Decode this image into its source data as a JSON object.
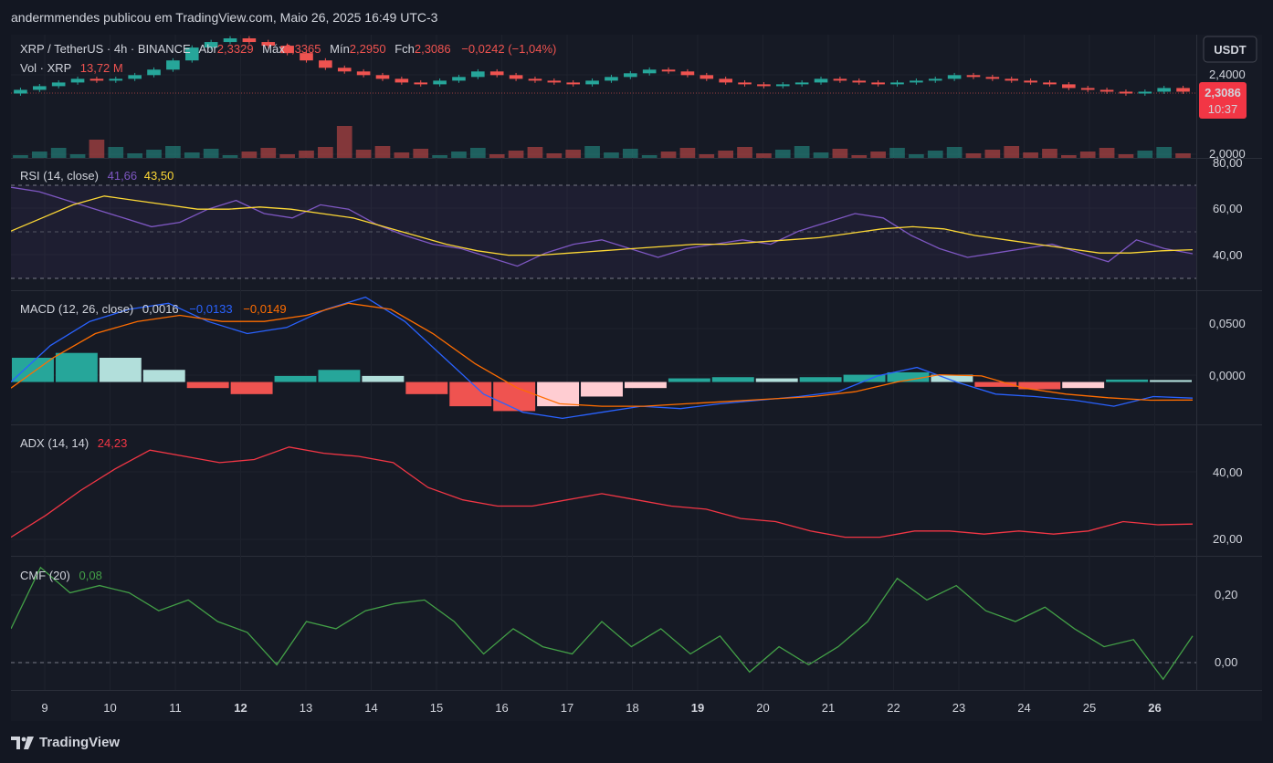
{
  "header": {
    "published_text": "andermmendes publicou em TradingView.com, Maio 26, 2025 16:49 UTC-3"
  },
  "symbol": {
    "name": "XRP / TetherUS · 4h · BINANCE",
    "open_label": "Abr",
    "open": "2,3329",
    "high_label": "Máx",
    "high": "2,3365",
    "low_label": "Mín",
    "low": "2,2950",
    "close_label": "Fch",
    "close": "2,3086",
    "change": "−0,0242 (−1,04%)"
  },
  "volume": {
    "label": "Vol · XRP",
    "value": "13,72 M"
  },
  "price_badge": {
    "value": "2,3086",
    "countdown": "10:37"
  },
  "currency_button": "USDT",
  "price_axis": [
    "2,4000",
    "2,0000"
  ],
  "indicators": {
    "rsi": {
      "label": "RSI (14, close)",
      "value1": "41,66",
      "value2": "43,50",
      "axis": [
        "80,00",
        "60,00",
        "40,00"
      ]
    },
    "macd": {
      "label": "MACD (12, 26, close)",
      "value1": "0,0016",
      "value2": "−0,0133",
      "value3": "−0,0149",
      "axis": [
        "0,0500",
        "0,0000"
      ]
    },
    "adx": {
      "label": "ADX (14, 14)",
      "value": "24,23",
      "axis": [
        "40,00",
        "20,00"
      ]
    },
    "cmf": {
      "label": "CMF (20)",
      "value": "0,08",
      "axis": [
        "0,20",
        "0,00"
      ]
    }
  },
  "time_axis": [
    "9",
    "10",
    "11",
    "12",
    "13",
    "14",
    "15",
    "16",
    "17",
    "18",
    "19",
    "20",
    "21",
    "22",
    "23",
    "24",
    "25",
    "26"
  ],
  "brand": "TradingView",
  "colors": {
    "up": "#26a69a",
    "down": "#ef5350",
    "rsi": "#7e57c2",
    "rsi_ma": "#fdd835",
    "macd": "#2962ff",
    "signal": "#ff6d00",
    "adx": "#f23645",
    "cmf": "#43a047"
  },
  "chart_data": [
    {
      "type": "candlestick",
      "title": "XRP / TetherUS · 4h · BINANCE",
      "x": [
        "9",
        "10",
        "11",
        "12",
        "13",
        "14",
        "15",
        "16",
        "17",
        "18",
        "19",
        "20",
        "21",
        "22",
        "23",
        "24",
        "25",
        "26"
      ],
      "close": [
        2.32,
        2.34,
        2.36,
        2.38,
        2.37,
        2.38,
        2.4,
        2.43,
        2.48,
        2.55,
        2.58,
        2.6,
        2.58,
        2.56,
        2.52,
        2.48,
        2.44,
        2.42,
        2.4,
        2.38,
        2.36,
        2.35,
        2.37,
        2.39,
        2.42,
        2.4,
        2.38,
        2.37,
        2.36,
        2.35,
        2.37,
        2.39,
        2.41,
        2.43,
        2.42,
        2.4,
        2.38,
        2.36,
        2.35,
        2.34,
        2.35,
        2.36,
        2.38,
        2.37,
        2.36,
        2.35,
        2.36,
        2.37,
        2.38,
        2.4,
        2.39,
        2.38,
        2.37,
        2.36,
        2.35,
        2.33,
        2.32,
        2.31,
        2.3,
        2.31,
        2.33,
        2.31
      ],
      "volume_last": "13,72 M",
      "ylim": [
        1.95,
        2.62
      ]
    },
    {
      "type": "line",
      "title": "RSI (14, close)",
      "series": [
        {
          "name": "RSI",
          "values": [
            72,
            70,
            66,
            62,
            58,
            54,
            56,
            62,
            66,
            60,
            58,
            64,
            62,
            55,
            50,
            46,
            44,
            40,
            36,
            42,
            46,
            48,
            44,
            40,
            44,
            46,
            48,
            46,
            52,
            56,
            60,
            58,
            50,
            44,
            40,
            42,
            44,
            46,
            42,
            38,
            48,
            44,
            41.66
          ]
        },
        {
          "name": "MA",
          "values": [
            52,
            58,
            64,
            68,
            66,
            64,
            62,
            62,
            63,
            62,
            60,
            58,
            54,
            50,
            46,
            43,
            41,
            41,
            42,
            43,
            44,
            45,
            46,
            46,
            47,
            48,
            49,
            51,
            53,
            54,
            53,
            50,
            48,
            46,
            44,
            42,
            42,
            43,
            43.5
          ]
        }
      ],
      "ylim": [
        25,
        85
      ]
    },
    {
      "type": "line",
      "title": "MACD (12, 26, close)",
      "series": [
        {
          "name": "MACD",
          "values": [
            0.0,
            0.03,
            0.05,
            0.06,
            0.065,
            0.05,
            0.04,
            0.045,
            0.06,
            0.07,
            0.05,
            0.02,
            -0.01,
            -0.025,
            -0.03,
            -0.025,
            -0.02,
            -0.022,
            -0.018,
            -0.015,
            -0.012,
            -0.008,
            0.005,
            0.012,
            0.0,
            -0.01,
            -0.012,
            -0.015,
            -0.02,
            -0.012,
            -0.0133
          ]
        },
        {
          "name": "Signal",
          "values": [
            -0.005,
            0.02,
            0.04,
            0.05,
            0.055,
            0.05,
            0.05,
            0.055,
            0.065,
            0.06,
            0.04,
            0.015,
            -0.005,
            -0.018,
            -0.02,
            -0.02,
            -0.018,
            -0.016,
            -0.014,
            -0.012,
            -0.008,
            0.0,
            0.006,
            0.005,
            -0.005,
            -0.01,
            -0.013,
            -0.015,
            -0.0149
          ]
        },
        {
          "name": "Histogram",
          "values": [
            0.02,
            0.024,
            0.02,
            0.01,
            -0.005,
            -0.01,
            0.005,
            0.01,
            0.005,
            -0.01,
            -0.02,
            -0.024,
            -0.02,
            -0.012,
            -0.005,
            0.003,
            0.004,
            0.003,
            0.004,
            0.006,
            0.008,
            0.006,
            -0.004,
            -0.006,
            -0.005,
            0.002,
            0.0016
          ]
        }
      ],
      "ylim": [
        -0.035,
        0.075
      ]
    },
    {
      "type": "line",
      "title": "ADX (14, 14)",
      "series": [
        {
          "name": "ADX",
          "values": [
            20,
            27,
            35,
            42,
            48,
            46,
            44,
            45,
            49,
            47,
            46,
            44,
            36,
            32,
            30,
            30,
            32,
            34,
            32,
            30,
            29,
            26,
            25,
            22,
            20,
            20,
            22,
            22,
            21,
            22,
            21,
            22,
            25,
            24,
            24.23
          ]
        }
      ],
      "ylim": [
        14,
        56
      ]
    },
    {
      "type": "line",
      "title": "CMF (20)",
      "series": [
        {
          "name": "CMF",
          "values": [
            0.1,
            0.27,
            0.2,
            0.22,
            0.2,
            0.15,
            0.18,
            0.12,
            0.09,
            0.0,
            0.12,
            0.1,
            0.15,
            0.17,
            0.18,
            0.12,
            0.03,
            0.1,
            0.05,
            0.03,
            0.12,
            0.05,
            0.1,
            0.03,
            0.08,
            -0.02,
            0.05,
            0.0,
            0.05,
            0.12,
            0.24,
            0.18,
            0.22,
            0.15,
            0.12,
            0.16,
            0.1,
            0.05,
            0.07,
            -0.04,
            0.08
          ]
        }
      ],
      "ylim": [
        -0.07,
        0.3
      ]
    }
  ]
}
